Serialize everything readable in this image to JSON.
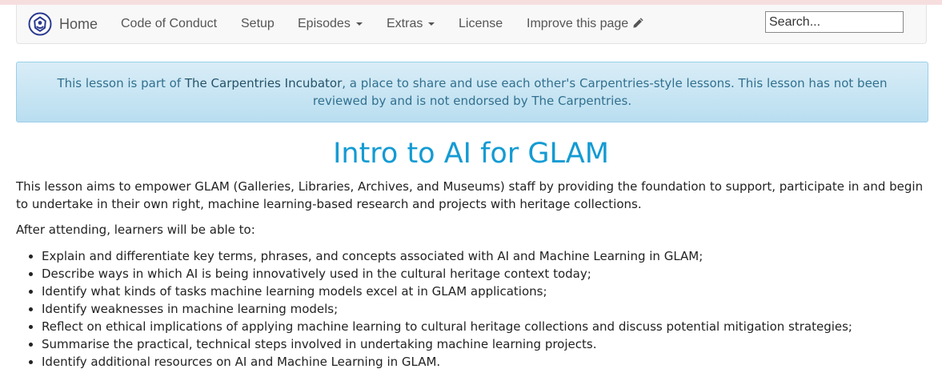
{
  "navbar": {
    "home_label": "Home",
    "items": [
      {
        "label": "Code of Conduct"
      },
      {
        "label": "Setup"
      },
      {
        "label": "Episodes"
      },
      {
        "label": "Extras"
      },
      {
        "label": "License"
      },
      {
        "label": "Improve this page"
      }
    ],
    "search_placeholder": "Search..."
  },
  "alert": {
    "prefix": "This lesson is part of ",
    "link_text": "The Carpentries Incubator",
    "suffix": ", a place to share and use each other's Carpentries-style lessons. This lesson has not been reviewed by and is not endorsed by The Carpentries."
  },
  "lesson": {
    "title": "Intro to AI for GLAM",
    "intro": "This lesson aims to empower GLAM (Galleries, Libraries, Archives, and Museums) staff by providing the foundation to support, participate in and begin to undertake in their own right, machine learning-based research and projects with heritage collections.",
    "after_heading": "After attending, learners will be able to:",
    "objectives": [
      "Explain and differentiate key terms, phrases, and concepts associated with AI and Machine Learning in GLAM;",
      "Describe ways in which AI is being innovatively used in the cultural heritage context today;",
      "Identify what kinds of tasks machine learning models excel at in GLAM applications;",
      "Identify weaknesses in machine learning models;",
      "Reflect on ethical implications of applying machine learning to cultural heritage collections and discuss potential mitigation strategies;",
      "Summarise the practical, technical steps involved in undertaking machine learning projects.",
      "Identify additional resources on AI and Machine Learning in GLAM."
    ]
  },
  "colors": {
    "title": "#139bd3",
    "alert_text": "#31708f",
    "alert_link": "#245269",
    "navbar_bg": "#f8f8f8",
    "top_strip": "#f6dede"
  }
}
